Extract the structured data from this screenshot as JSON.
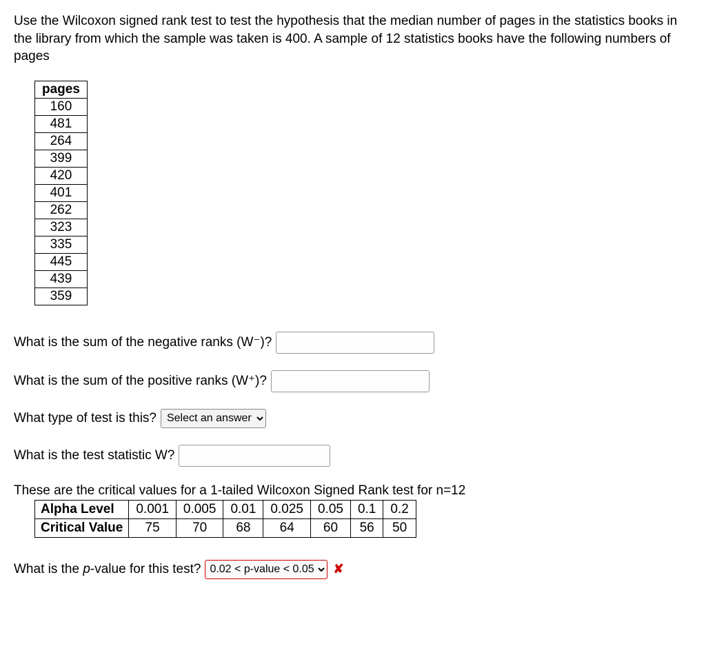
{
  "intro": "Use the Wilcoxon signed rank test to test the hypothesis that the median number of pages in the statistics books in the library from which the sample was taken is 400. A sample of 12 statistics books have the following numbers of pages",
  "pages_header": "pages",
  "pages_values": [
    "160",
    "481",
    "264",
    "399",
    "420",
    "401",
    "262",
    "323",
    "335",
    "445",
    "439",
    "359"
  ],
  "q_neg_ranks": "What is the sum of the negative ranks (W⁻)?",
  "q_pos_ranks": "What is the sum of the positive ranks (W⁺)?",
  "q_test_type": "What type of test is this?",
  "q_test_stat": "What is the test statistic W?",
  "test_type_placeholder": "Select an answer",
  "crit_intro": "These are the critical values for a 1-tailed Wilcoxon Signed Rank test for n=12",
  "crit_row_labels": [
    "Alpha Level",
    "Critical Value"
  ],
  "crit_alpha": [
    "0.001",
    "0.005",
    "0.01",
    "0.025",
    "0.05",
    "0.1",
    "0.2"
  ],
  "crit_values": [
    "75",
    "70",
    "68",
    "64",
    "60",
    "56",
    "50"
  ],
  "q_pvalue_pre": "What is the ",
  "q_pvalue_ital": "p",
  "q_pvalue_post": "-value for this test?",
  "pvalue_selected": "0.02 < p-value < 0.05",
  "wrong_mark": "✘"
}
